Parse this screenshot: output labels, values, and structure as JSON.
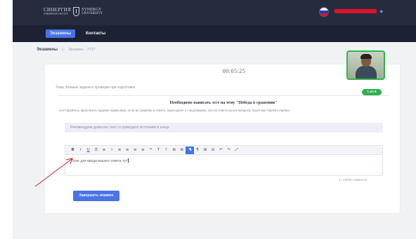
{
  "header": {
    "logo": {
      "name": "СИНЕРГИЯ",
      "name_sub": "УНИВЕРСИТЕТ",
      "name2": "SYNERGY",
      "name2_sub": "UNIVERSITY"
    },
    "flag_colors": [
      "#ffffff",
      "#1c3fb0",
      "#e0112b"
    ],
    "user_icon": "user-icon"
  },
  "nav": {
    "items": [
      {
        "label": "Экзамены",
        "active": true
      },
      {
        "label": "Контакты",
        "active": false
      }
    ]
  },
  "breadcrumb": {
    "items": [
      "Экзамены",
      "Экзамен - 7727"
    ]
  },
  "exam": {
    "timer": "00:05:25",
    "topic_line": "Тема: Боевые задачи и проверки при подготовке",
    "badge": "1 из 5",
    "task_title": "Необходимо написать эссе на тему \"Победа в сражении\"",
    "task_description": "Постарайтесь выполнить задание правильно, если не уверены в ответе, переходите к следующему. После ответа на все вопросы будет выставлена оценка.",
    "hint": "Рекомендуем дописать текст и приводите источники в конце",
    "editor_text": "Поле для ввода вашего ответа тут",
    "counter": "1 / 10000 символов",
    "finish_button": "Завершить экзамен"
  },
  "toolbar": {
    "buttons": [
      {
        "label": "B",
        "icon": "bold-icon"
      },
      {
        "label": "I",
        "icon": "italic-icon"
      },
      {
        "label": "U",
        "icon": "underline-icon"
      },
      {
        "label": "☰",
        "icon": "unordered-list-icon"
      },
      {
        "label": "≡",
        "icon": "ordered-list-icon"
      },
      {
        "label": "Ⅰ",
        "icon": "clear-format-icon"
      },
      {
        "label": "≡",
        "icon": "align-left-icon"
      },
      {
        "label": "≡",
        "icon": "align-center-icon"
      },
      {
        "label": "≡",
        "icon": "align-right-icon"
      },
      {
        "label": "≡",
        "icon": "align-justify-icon"
      },
      {
        "label": "❝",
        "icon": "quote-icon"
      },
      {
        "label": "T",
        "icon": "font-size-icon"
      },
      {
        "label": "T",
        "icon": "text-color-icon"
      },
      {
        "label": "⊞",
        "icon": "table-icon"
      },
      {
        "label": "⊞",
        "icon": "table-row-icon"
      },
      {
        "label": "◥",
        "icon": "highlight-icon",
        "active": true
      },
      {
        "label": "¶",
        "icon": "paragraph-icon"
      },
      {
        "label": "⊠",
        "icon": "image-icon"
      },
      {
        "label": "⊟",
        "icon": "media-icon"
      },
      {
        "label": "↶",
        "icon": "undo-icon"
      },
      {
        "label": "↷",
        "icon": "redo-icon"
      },
      {
        "label": "⤢",
        "icon": "fullscreen-icon"
      }
    ],
    "accent_color": "#3b78e7"
  },
  "colors": {
    "header_bg": "#262c3d",
    "nav_bg": "#1c2233",
    "primary": "#4a73e6",
    "success": "#30b04a",
    "page_bg": "#f1f2f4",
    "annotation_arrow": "#d62020"
  }
}
